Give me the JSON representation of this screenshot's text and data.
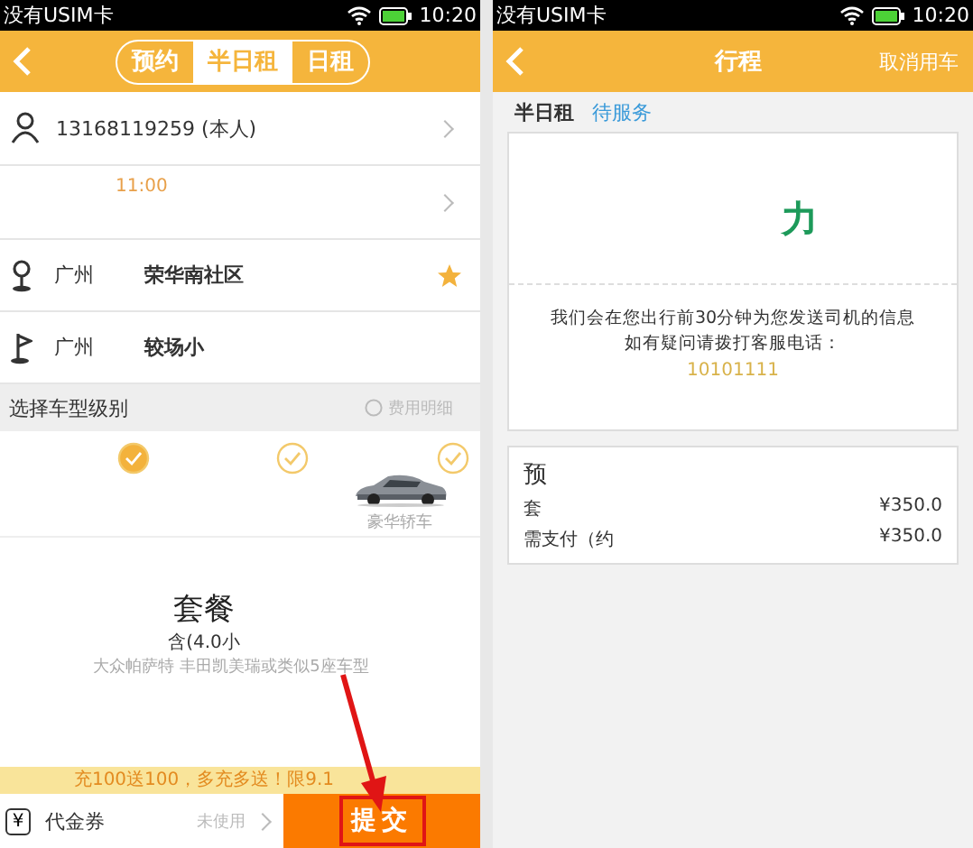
{
  "left_screen": {
    "status_bar": {
      "carrier": "没有USIM卡",
      "time": "10:20"
    },
    "tabs": [
      {
        "label": "预约",
        "selected": false
      },
      {
        "label": "半日租",
        "selected": true
      },
      {
        "label": "日租",
        "selected": false
      }
    ],
    "contact": {
      "phone": "13168119259 (本人)"
    },
    "time_row": {
      "time": "11:00"
    },
    "places": [
      {
        "kind": "start",
        "city": "广州",
        "name": "荣华南社区",
        "starred": true
      },
      {
        "kind": "end",
        "city": "广州",
        "name": "较场小",
        "starred": false
      }
    ],
    "section": {
      "title": "选择车型级别",
      "link": "费用明细"
    },
    "car_options": [
      {
        "selected": true
      },
      {
        "selected": false
      },
      {
        "selected": false,
        "label": "豪华轿车",
        "kind": "picture"
      }
    ],
    "package": {
      "title": "套餐",
      "hours": "含(4.0小",
      "models": "大众帕萨特 丰田凯美瑞或类似5座车型"
    },
    "promo": "充100送100，多充多送！限9.1",
    "bottom": {
      "coupon_icon": "¥",
      "coupon": "代金券",
      "coupon_state": "未使用",
      "submit": "提交"
    }
  },
  "right_screen": {
    "status_bar": {
      "carrier": "没有USIM卡",
      "time": "10:20"
    },
    "title": "行程",
    "cancel": "取消用车",
    "order": {
      "type": "半日租",
      "status": "待服务"
    },
    "card": {
      "headline": "力",
      "message": [
        "我们会在您出行前30分钟为您发送司机的信息",
        "如有疑问请拨打客服电话："
      ],
      "phone": "10101111"
    },
    "fees": {
      "heading": "预",
      "rows": [
        {
          "label": "套",
          "value": "¥350.0"
        },
        {
          "label": "需支付（约",
          "value": "¥350.0"
        }
      ]
    }
  }
}
